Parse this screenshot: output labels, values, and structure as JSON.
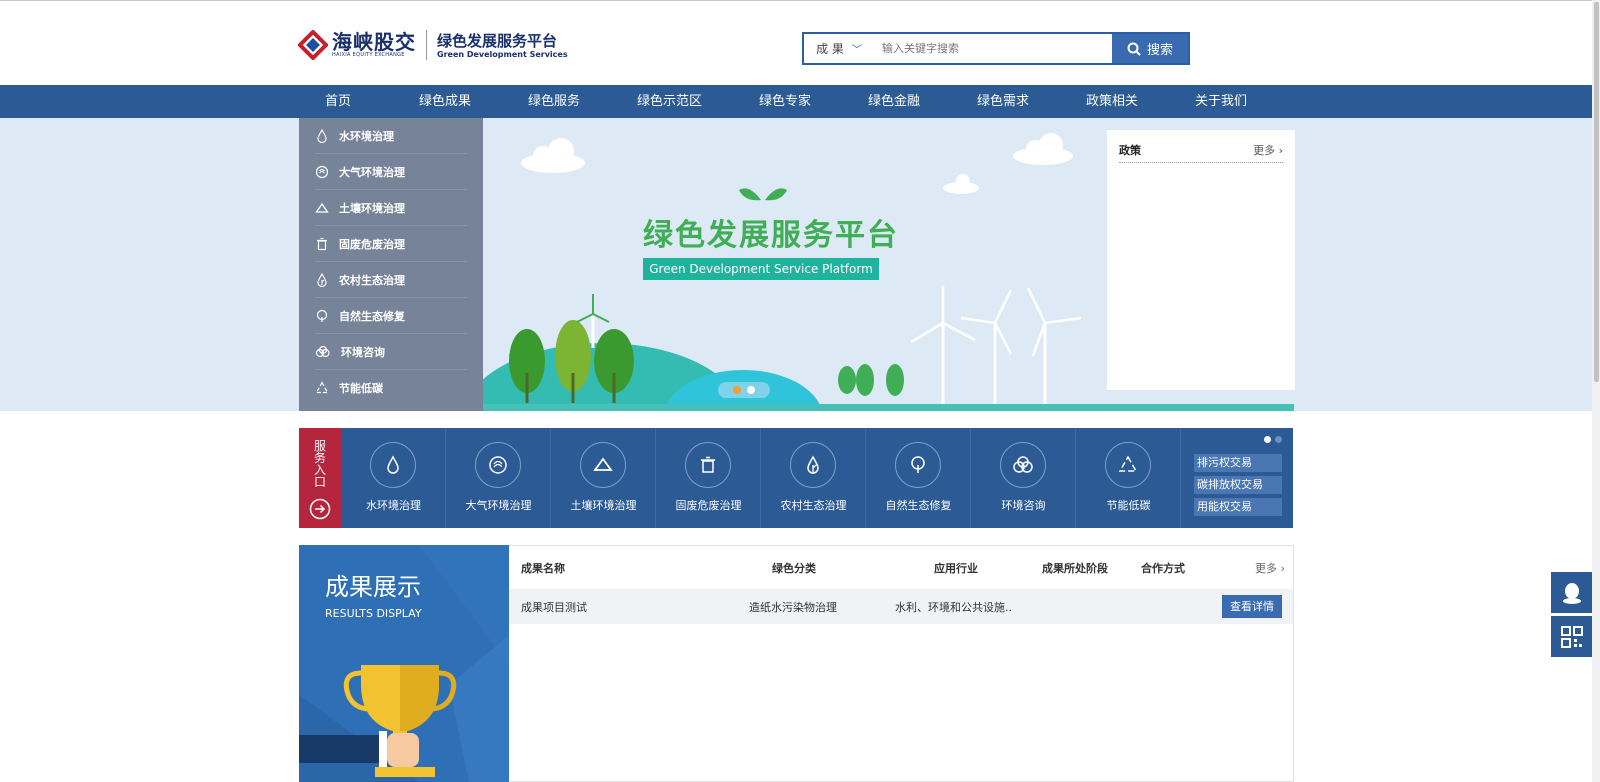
{
  "header": {
    "logo_cn": "海峡股交",
    "logo_en": "HAIXIA EQUITY EXCHANGE",
    "platform_title": "绿色发展服务平台",
    "platform_subtitle": "Green Development Services"
  },
  "search": {
    "category": "成 果",
    "placeholder": "输入关键字搜索",
    "button_label": "搜索"
  },
  "nav": {
    "items": [
      "首页",
      "绿色成果",
      "绿色服务",
      "绿色示范区",
      "绿色专家",
      "绿色金融",
      "绿色需求",
      "政策相关",
      "关于我们"
    ]
  },
  "sidebar": {
    "items": [
      {
        "label": "水环境治理",
        "icon": "water-drop-icon"
      },
      {
        "label": "大气环境治理",
        "icon": "air-icon"
      },
      {
        "label": "土壤环境治理",
        "icon": "soil-icon"
      },
      {
        "label": "固废危废治理",
        "icon": "trash-icon"
      },
      {
        "label": "农村生态治理",
        "icon": "leaf-drop-icon"
      },
      {
        "label": "自然生态修复",
        "icon": "tree-icon"
      },
      {
        "label": "环境咨询",
        "icon": "cloud-icon"
      },
      {
        "label": "节能低碳",
        "icon": "recycle-icon"
      }
    ]
  },
  "banner": {
    "title": "绿色发展服务平台",
    "ribbon": "Green Development Service Platform",
    "slide_count": 2,
    "active_slide": 1
  },
  "policy": {
    "title": "政策",
    "more": "更多"
  },
  "service": {
    "label": "服务入口",
    "items": [
      {
        "label": "水环境治理",
        "icon": "water-drop-icon"
      },
      {
        "label": "大气环境治理",
        "icon": "air-icon"
      },
      {
        "label": "土壤环境治理",
        "icon": "soil-icon"
      },
      {
        "label": "固废危废治理",
        "icon": "trash-icon"
      },
      {
        "label": "农村生态治理",
        "icon": "leaf-drop-icon"
      },
      {
        "label": "自然生态修复",
        "icon": "tree-icon"
      },
      {
        "label": "环境咨询",
        "icon": "cloud-icon"
      },
      {
        "label": "节能低碳",
        "icon": "recycle-icon"
      }
    ],
    "trades": [
      "排污权交易",
      "碳排放权交易",
      "用能权交易"
    ]
  },
  "results": {
    "title": "成果展示",
    "subtitle": "RESULTS DISPLAY",
    "columns": [
      "成果名称",
      "绿色分类",
      "应用行业",
      "成果所处阶段",
      "合作方式"
    ],
    "more": "更多",
    "rows": [
      {
        "name": "成果项目测试",
        "category": "造纸水污染物治理",
        "industry": "水利、环境和公共设施..",
        "stage": "",
        "cooperation": "",
        "action": "查看详情"
      }
    ]
  },
  "colors": {
    "primary": "#2b5a94",
    "accent": "#3a6bb0",
    "service_label": "#b6253e",
    "banner_green": "#3fae56"
  }
}
